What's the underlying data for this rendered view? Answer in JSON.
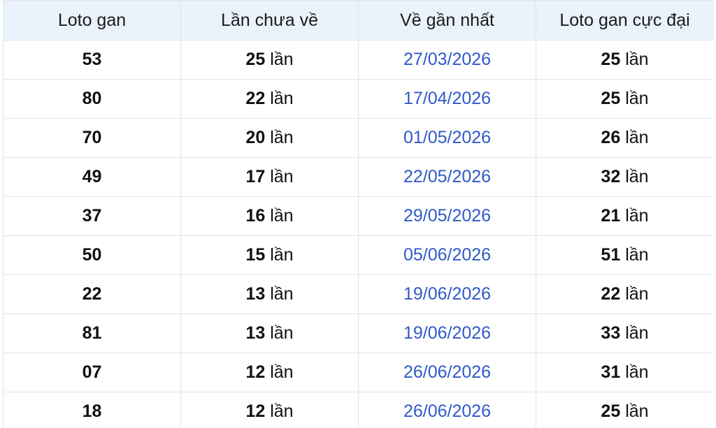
{
  "colors": {
    "header_bg": "#eaf2fc",
    "border": "#dfe3ea",
    "date_text": "#2f59c7",
    "text": "#111111"
  },
  "headers": [
    "Loto gan",
    "Lần chưa về",
    "Về gần nhất",
    "Loto gan cực đại"
  ],
  "unit": "lần",
  "rows": [
    {
      "loto": "53",
      "chua_ve": "25",
      "gan_nhat": "27/03/2026",
      "cuc_dai": "25"
    },
    {
      "loto": "80",
      "chua_ve": "22",
      "gan_nhat": "17/04/2026",
      "cuc_dai": "25"
    },
    {
      "loto": "70",
      "chua_ve": "20",
      "gan_nhat": "01/05/2026",
      "cuc_dai": "26"
    },
    {
      "loto": "49",
      "chua_ve": "17",
      "gan_nhat": "22/05/2026",
      "cuc_dai": "32"
    },
    {
      "loto": "37",
      "chua_ve": "16",
      "gan_nhat": "29/05/2026",
      "cuc_dai": "21"
    },
    {
      "loto": "50",
      "chua_ve": "15",
      "gan_nhat": "05/06/2026",
      "cuc_dai": "51"
    },
    {
      "loto": "22",
      "chua_ve": "13",
      "gan_nhat": "19/06/2026",
      "cuc_dai": "22"
    },
    {
      "loto": "81",
      "chua_ve": "13",
      "gan_nhat": "19/06/2026",
      "cuc_dai": "33"
    },
    {
      "loto": "07",
      "chua_ve": "12",
      "gan_nhat": "26/06/2026",
      "cuc_dai": "31"
    },
    {
      "loto": "18",
      "chua_ve": "12",
      "gan_nhat": "26/06/2026",
      "cuc_dai": "25"
    }
  ]
}
